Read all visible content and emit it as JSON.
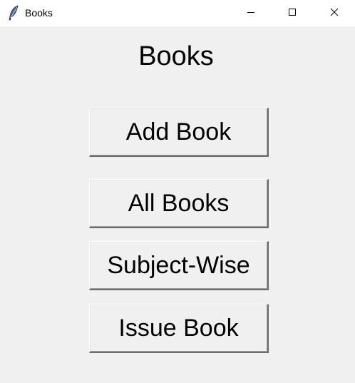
{
  "window": {
    "title": "Books",
    "icon": "feather-icon",
    "controls": [
      "minimize-icon",
      "maximize-icon",
      "close-icon"
    ]
  },
  "main": {
    "heading": "Books",
    "buttons": [
      {
        "label": "Add Book"
      },
      {
        "label": "All Books"
      },
      {
        "label": "Subject-Wise"
      },
      {
        "label": "Issue Book"
      }
    ]
  },
  "colors": {
    "background": "#f0f0f0",
    "titlebar": "#ffffff",
    "text": "#000000"
  }
}
